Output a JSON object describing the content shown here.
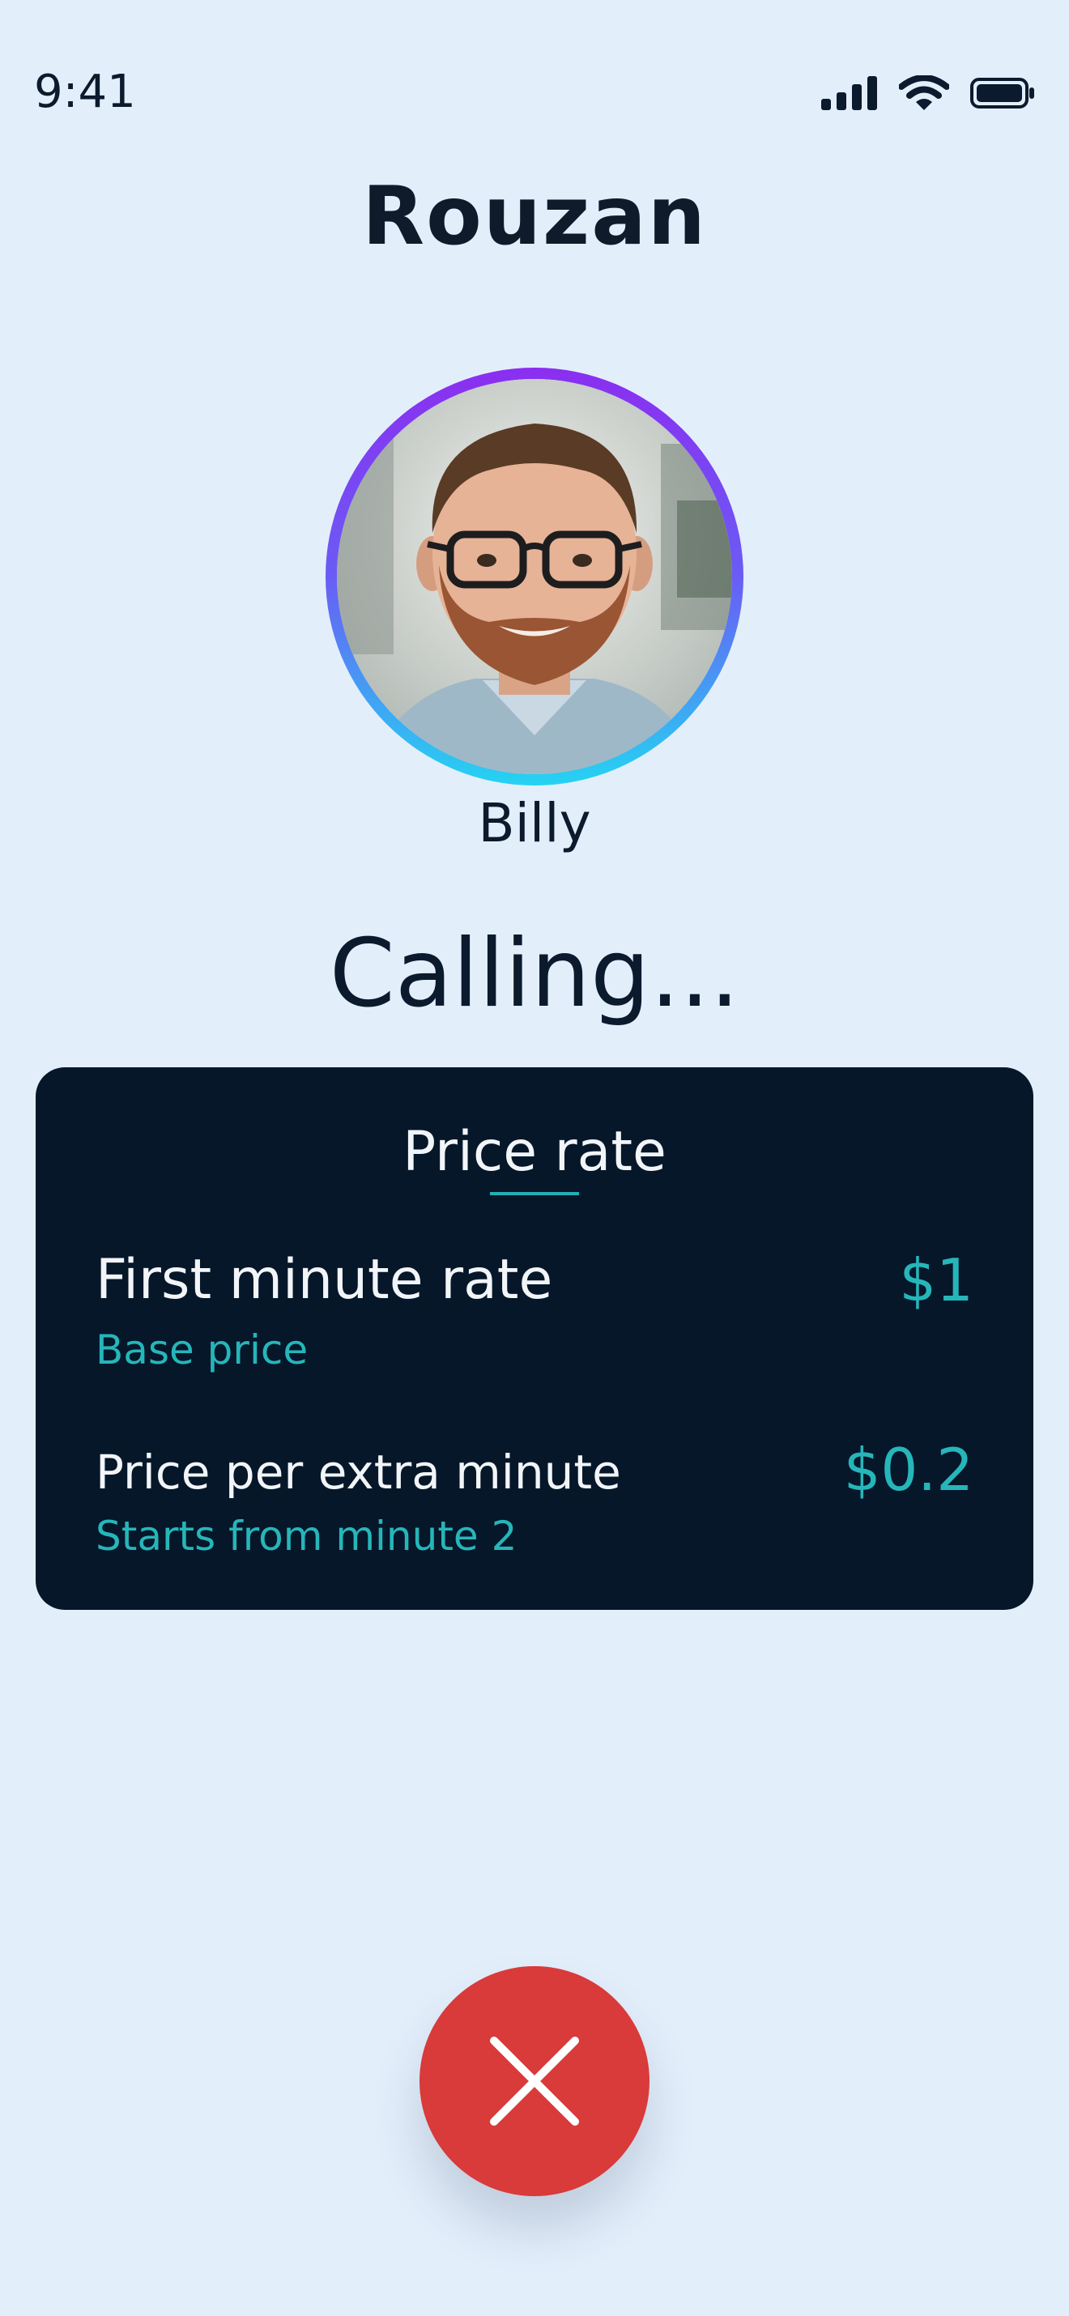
{
  "status_bar": {
    "time": "9:41",
    "icons": [
      "cellular-signal-icon",
      "wifi-icon",
      "battery-icon"
    ]
  },
  "brand": {
    "name": "Rouzan"
  },
  "contact": {
    "name": "Billy",
    "avatar": "profile-photo"
  },
  "call": {
    "status": "Calling..."
  },
  "price_card": {
    "title": "Price rate",
    "rates": [
      {
        "label": "First minute rate",
        "sublabel": "Base price",
        "value": "$1"
      },
      {
        "label": "Price per extra minute",
        "sublabel": "Starts from minute 2",
        "value": "$0.2"
      }
    ]
  },
  "actions": {
    "end_call_icon": "close-icon"
  },
  "colors": {
    "background": "#e3eefb",
    "card": "#06172a",
    "accent": "#26b6b9",
    "end_call": "#d93a3a",
    "ring_top": "#8b2ef0",
    "ring_bottom": "#25d3f2"
  }
}
